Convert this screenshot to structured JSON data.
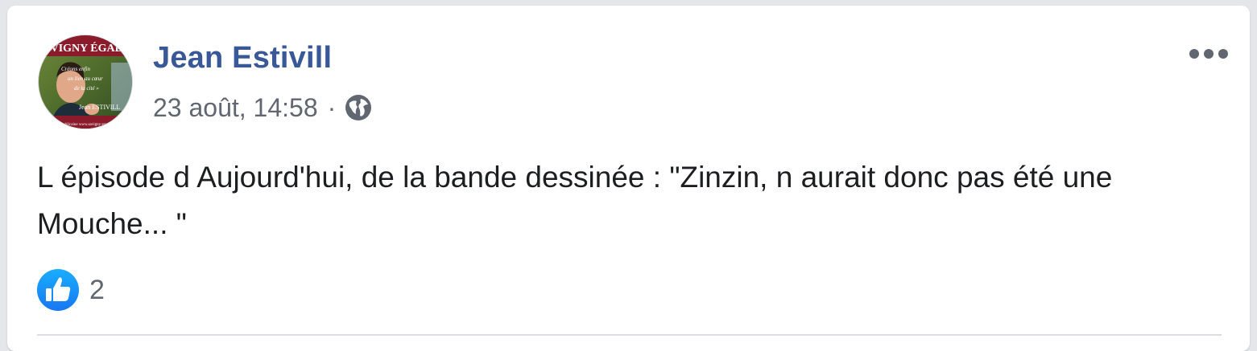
{
  "post": {
    "author": "Jean Estivill",
    "timestamp": "23 août, 14:58",
    "separator": "·",
    "privacy_icon": "globe-icon",
    "more_icon": "more-horizontal-icon",
    "text": "L épisode d Aujourd'hui, de la bande dessinée : \"Zinzin, n aurait donc pas été une Mouche... \"",
    "reactions": {
      "icon": "like-icon",
      "count": "2"
    },
    "avatar": {
      "banner_text": "VIGNY ÉGALI",
      "quote_line1": "Créons enfin",
      "quote_line2": "un lien au cœur",
      "quote_line3": "de la cité »",
      "name_text": "Jean ESTIVILL",
      "footer_text": "républicaine www.savigny-egalite"
    }
  },
  "colors": {
    "author_link": "#385898",
    "secondary_text": "#606770",
    "like_blue": "#1877f2",
    "avatar_banner": "#8b1a2b"
  }
}
